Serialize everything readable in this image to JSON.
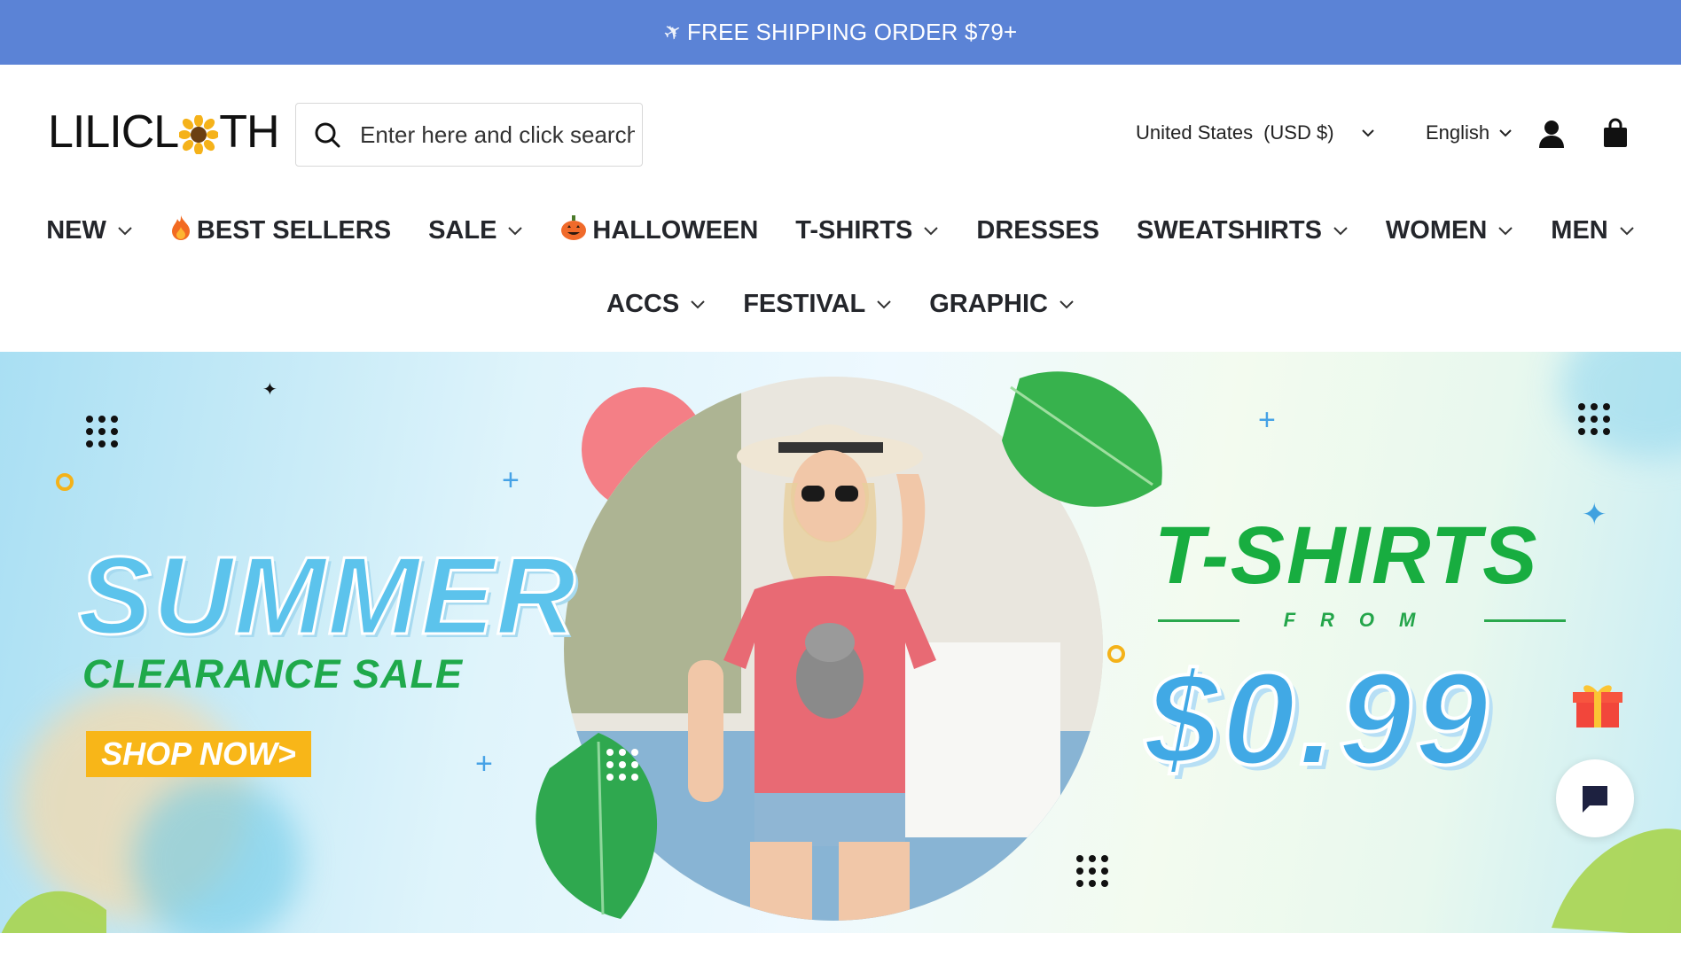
{
  "announcement": {
    "text": "FREE SHIPPING ORDER $79+",
    "icon": "airplane-icon"
  },
  "header": {
    "logo_text_left": "LILICL",
    "logo_text_right": "TH",
    "search": {
      "placeholder": "Enter here and click search"
    },
    "country": {
      "label": "United States",
      "currency": "(USD $)"
    },
    "language": {
      "label": "English"
    }
  },
  "nav": {
    "row1": [
      {
        "label": "NEW",
        "has_dropdown": true
      },
      {
        "label": "BEST SELLERS",
        "icon": "fire-icon",
        "has_dropdown": false
      },
      {
        "label": "SALE",
        "has_dropdown": true
      },
      {
        "label": "HALLOWEEN",
        "icon": "pumpkin-icon",
        "has_dropdown": false
      },
      {
        "label": "T-SHIRTS",
        "has_dropdown": true
      },
      {
        "label": "DRESSES",
        "has_dropdown": false
      },
      {
        "label": "SWEATSHIRTS",
        "has_dropdown": true
      },
      {
        "label": "WOMEN",
        "has_dropdown": true
      },
      {
        "label": "MEN",
        "has_dropdown": true
      }
    ],
    "row2": [
      {
        "label": "ACCS",
        "has_dropdown": true
      },
      {
        "label": "FESTIVAL",
        "has_dropdown": true
      },
      {
        "label": "GRAPHIC",
        "has_dropdown": true
      }
    ]
  },
  "hero": {
    "headline": "SUMMER",
    "subheadline": "CLEARANCE SALE",
    "cta": "SHOP NOW>",
    "product": "T-SHIRTS",
    "from": "FROM",
    "price": "$0.99"
  },
  "colors": {
    "announcement_bg": "#5b83d6",
    "summer_blue": "#5cc3ec",
    "clearance_green": "#1fa94b",
    "cta_yellow": "#f8b618",
    "price_blue": "#41a9e5"
  }
}
